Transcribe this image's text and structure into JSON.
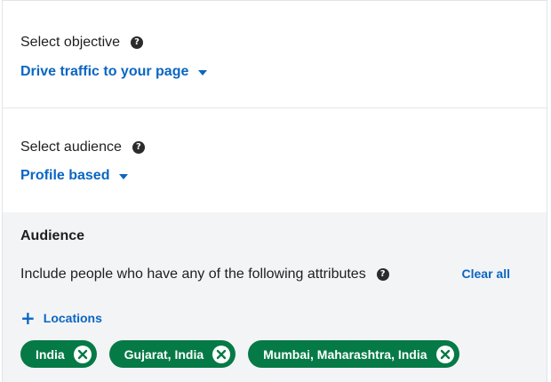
{
  "objective": {
    "label": "Select objective",
    "value": "Drive traffic to your page",
    "help_icon": "?"
  },
  "audience_type": {
    "label": "Select audience",
    "value": "Profile based",
    "help_icon": "?"
  },
  "audience": {
    "heading": "Audience",
    "include_text": "Include people who have any of the following attributes",
    "help_icon": "?",
    "clear_all": "Clear all",
    "add_location": "Locations",
    "plus_icon": "+",
    "locations": [
      {
        "label": "India"
      },
      {
        "label": "Gujarat, India"
      },
      {
        "label": "Mumbai, Maharashtra, India"
      }
    ]
  },
  "colors": {
    "link_blue": "#0a66c2",
    "pill_green": "#067a46",
    "panel_bg": "#f3f4f6",
    "text_dark": "#1f1f1f"
  },
  "icons": {
    "help": "question-circle-icon",
    "dropdown": "caret-down-icon",
    "add": "plus-icon",
    "remove": "close-circle-icon"
  }
}
